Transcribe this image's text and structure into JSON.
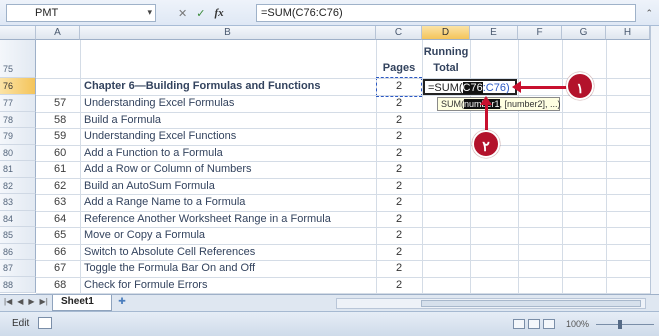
{
  "formula_bar": {
    "name_box": "PMT",
    "cancel_glyph": "✕",
    "enter_glyph": "✓",
    "fx_label": "fx",
    "formula": "=SUM(C76:C76)"
  },
  "columns": [
    "A",
    "B",
    "C",
    "D",
    "E",
    "F",
    "G",
    "H"
  ],
  "header_row": {
    "row_num": "76",
    "prev_row_num": "75",
    "title": "Chapter 6—Building Formulas and Functions",
    "pages_label": "Pages",
    "running_total_line1": "Running",
    "running_total_line2": "Total",
    "pages_value": "2"
  },
  "active_cell": {
    "prefix": "=SUM(",
    "highlight": "C76",
    "suffix": ":C76)"
  },
  "tooltip": {
    "fn": "SUM(",
    "highlight": "number1",
    "rest": ", [number2], ...)"
  },
  "rows": [
    {
      "row": "77",
      "num": "57",
      "title": "Understanding Excel Formulas",
      "pages": "2"
    },
    {
      "row": "78",
      "num": "58",
      "title": "Build a Formula",
      "pages": "2"
    },
    {
      "row": "79",
      "num": "59",
      "title": "Understanding Excel Functions",
      "pages": "2"
    },
    {
      "row": "80",
      "num": "60",
      "title": "Add a Function to a Formula",
      "pages": "2"
    },
    {
      "row": "81",
      "num": "61",
      "title": "Add a Row or Column of Numbers",
      "pages": "2"
    },
    {
      "row": "82",
      "num": "62",
      "title": "Build an AutoSum Formula",
      "pages": "2"
    },
    {
      "row": "83",
      "num": "63",
      "title": "Add a Range Name to a Formula",
      "pages": "2"
    },
    {
      "row": "84",
      "num": "64",
      "title": "Reference Another Worksheet Range in a Formula",
      "pages": "2"
    },
    {
      "row": "85",
      "num": "65",
      "title": "Move or Copy a Formula",
      "pages": "2"
    },
    {
      "row": "86",
      "num": "66",
      "title": "Switch to Absolute Cell References",
      "pages": "2"
    },
    {
      "row": "87",
      "num": "67",
      "title": "Toggle the Formula Bar On and Off",
      "pages": "2"
    },
    {
      "row": "88",
      "num": "68",
      "title": "Check for Formule Errors",
      "pages": "2"
    }
  ],
  "callouts": {
    "one": "١",
    "two": "٢"
  },
  "sheet_tabs": {
    "active": "Sheet1"
  },
  "status": {
    "mode": "Edit",
    "zoom": "100%"
  }
}
